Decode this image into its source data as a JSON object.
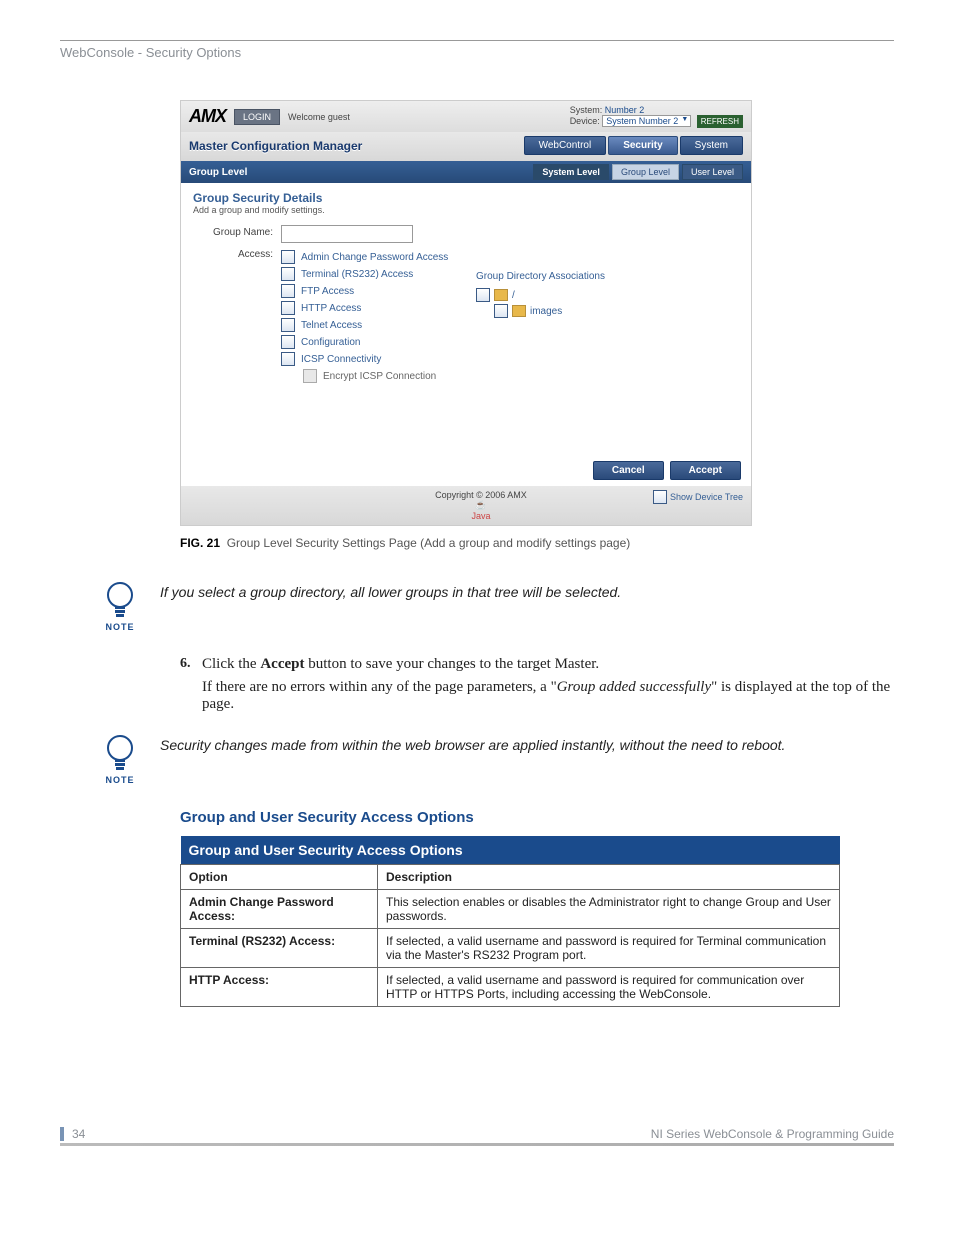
{
  "header": "WebConsole - Security Options",
  "screenshot": {
    "logo": "AMX",
    "login_btn": "LOGIN",
    "welcome": "Welcome guest",
    "system_label": "System:",
    "system_value": "Number 2",
    "device_label": "Device:",
    "device_value": "System Number 2",
    "refresh": "REFRESH",
    "mcm": "Master Configuration Manager",
    "main_tabs": [
      "WebControl",
      "Security",
      "System"
    ],
    "subbar_title": "Group Level",
    "sub_tabs": [
      "System Level",
      "Group Level",
      "User Level"
    ],
    "gsd_title": "Group Security Details",
    "gsd_sub": "Add a group and modify settings.",
    "group_name_label": "Group Name:",
    "access_label": "Access:",
    "access_options": [
      "Admin Change Password Access",
      "Terminal (RS232) Access",
      "FTP Access",
      "HTTP Access",
      "Telnet Access",
      "Configuration",
      "ICSP Connectivity"
    ],
    "access_sub": "Encrypt ICSP Connection",
    "assoc_title": "Group Directory Associations",
    "tree_root": "/",
    "tree_child": "images",
    "cancel": "Cancel",
    "accept": "Accept",
    "copyright": "Copyright © 2006 AMX",
    "java": "Java",
    "show_device_tree": "Show Device Tree"
  },
  "fig_label": "FIG. 21",
  "fig_text": "Group Level Security Settings Page (Add a group and modify settings page)",
  "note1": "If you select a group directory, all lower groups in that tree will be selected.",
  "step_num": "6.",
  "step_text_a": "Click the ",
  "step_text_bold": "Accept",
  "step_text_b": " button to save your changes to the target Master.",
  "step_para": "If there are no errors within any of the page parameters, a \"",
  "step_para_italic": "Group added successfully",
  "step_para_end": "\" is displayed at the top of the page.",
  "note2": "Security changes made from within the web browser are applied instantly, without the need to reboot.",
  "section_heading": "Group and User Security Access Options",
  "table": {
    "title": "Group and User Security Access Options",
    "cols": [
      "Option",
      "Description"
    ],
    "rows": [
      {
        "opt": "Admin Change Password Access:",
        "desc": "This selection enables or disables the Administrator right to change Group and User passwords."
      },
      {
        "opt": "Terminal (RS232) Access:",
        "desc": "If selected, a valid username and password is required for Terminal communication via the Master's RS232 Program port."
      },
      {
        "opt": "HTTP Access:",
        "desc": "If selected, a valid username and password is required for communication over HTTP or HTTPS Ports, including accessing the WebConsole."
      }
    ]
  },
  "note_label": "NOTE",
  "footer": {
    "page": "34",
    "doc": "NI Series WebConsole & Programming Guide"
  }
}
